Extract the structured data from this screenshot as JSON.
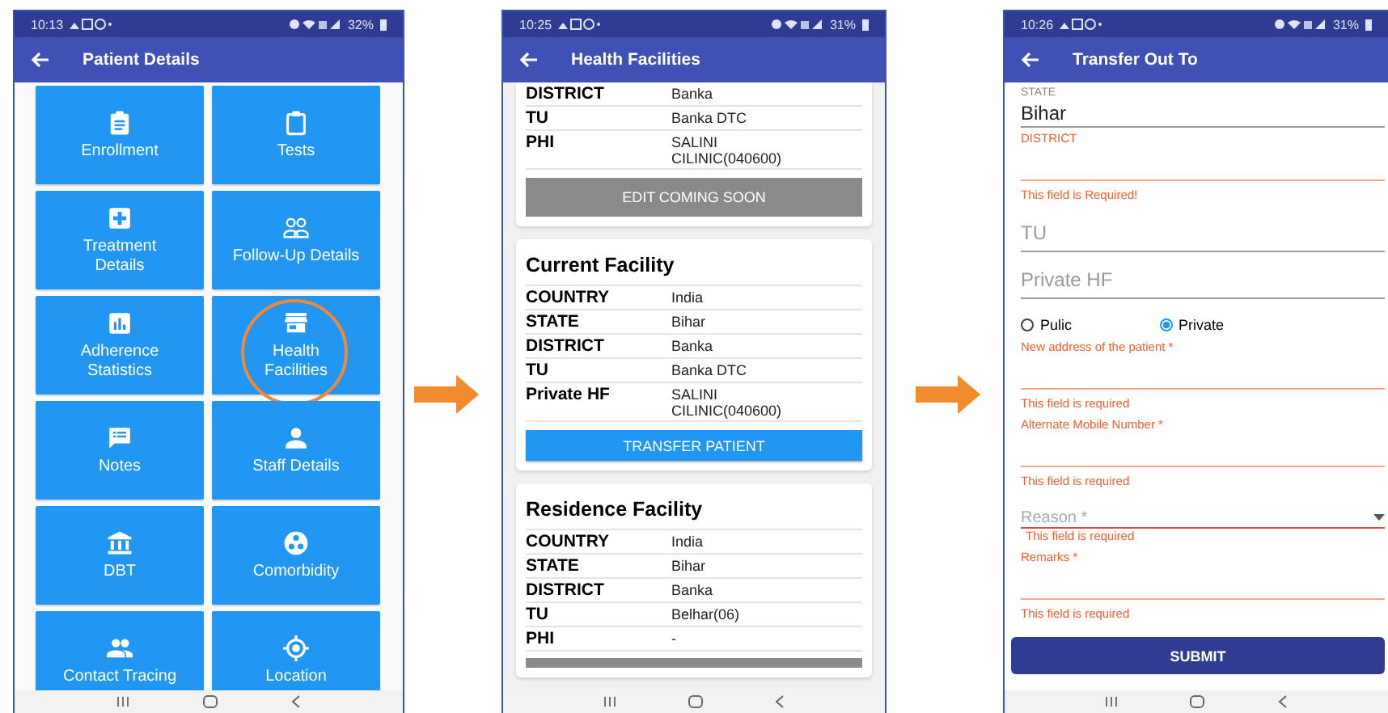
{
  "screens": [
    {
      "kind": "menu",
      "time": "10:13",
      "battery": "32%",
      "title": "Patient Details",
      "tiles": [
        {
          "label": "Enrollment",
          "highlighted": false
        },
        {
          "label": "Tests",
          "highlighted": false
        },
        {
          "label": "Treatment Details",
          "highlighted": false
        },
        {
          "label": "Follow-Up Details",
          "highlighted": false
        },
        {
          "label": "Adherence Statistics",
          "highlighted": false
        },
        {
          "label": "Health Facilities",
          "highlighted": true
        },
        {
          "label": "Notes",
          "highlighted": false
        },
        {
          "label": "Staff Details",
          "highlighted": false
        },
        {
          "label": "DBT",
          "highlighted": false
        },
        {
          "label": "Comorbidity",
          "highlighted": false
        },
        {
          "label": "Contact Tracing",
          "highlighted": false
        },
        {
          "label": "Location",
          "highlighted": false
        }
      ]
    },
    {
      "kind": "facilities",
      "time": "10:25",
      "battery": "31%",
      "title": "Health Facilities",
      "cards": [
        {
          "rows": [
            {
              "label": "DISTRICT",
              "value": "Banka"
            },
            {
              "label": "TU",
              "value": "Banka DTC"
            },
            {
              "label": "PHI",
              "value": "SALINI CILINIC(040600)"
            }
          ],
          "button": {
            "label": "EDIT COMING SOON",
            "disabled": true
          }
        },
        {
          "title": "Current Facility",
          "rows": [
            {
              "label": "COUNTRY",
              "value": "India"
            },
            {
              "label": "STATE",
              "value": "Bihar"
            },
            {
              "label": "DISTRICT",
              "value": "Banka"
            },
            {
              "label": "TU",
              "value": "Banka DTC"
            },
            {
              "label": "Private HF",
              "value": "SALINI CILINIC(040600)"
            }
          ],
          "button": {
            "label": "TRANSFER PATIENT",
            "disabled": false
          }
        },
        {
          "title": "Residence Facility",
          "rows": [
            {
              "label": "COUNTRY",
              "value": "India"
            },
            {
              "label": "STATE",
              "value": "Bihar"
            },
            {
              "label": "DISTRICT",
              "value": "Banka"
            },
            {
              "label": "TU",
              "value": "Belhar(06)"
            },
            {
              "label": "PHI",
              "value": "-"
            }
          ],
          "partial_button": true
        }
      ]
    },
    {
      "kind": "form",
      "time": "10:26",
      "battery": "31%",
      "title": "Transfer Out To",
      "fields": [
        {
          "kind": "text",
          "label": "STATE",
          "value": "Bihar",
          "error": false
        },
        {
          "kind": "text",
          "label": "DISTRICT",
          "error": true,
          "error_text": "This field is Required!"
        },
        {
          "kind": "text",
          "placeholder": "TU",
          "error": false
        },
        {
          "kind": "text",
          "placeholder": "Private HF",
          "error": false
        },
        {
          "kind": "radio",
          "options": [
            {
              "label": "Pulic",
              "selected": false
            },
            {
              "label": "Private",
              "selected": true
            }
          ]
        },
        {
          "kind": "text",
          "label": "New address of the patient *",
          "error": true,
          "error_text": "This field is required"
        },
        {
          "kind": "text",
          "label": "Alternate Mobile Number *",
          "error": true,
          "error_text": "This field is required"
        },
        {
          "kind": "dropdown",
          "placeholder": "Reason *",
          "error": true,
          "error_text": "This field is required"
        },
        {
          "kind": "text",
          "label": "Remarks *",
          "error": true,
          "error_text": "This field is required"
        }
      ],
      "submit": "SUBMIT"
    }
  ]
}
